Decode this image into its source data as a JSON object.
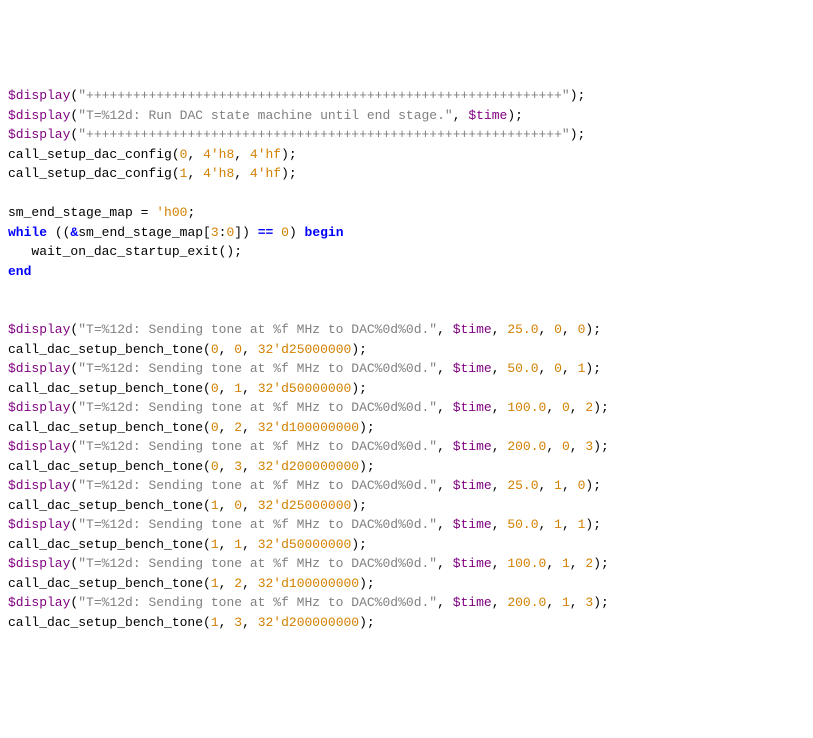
{
  "lines": [
    {
      "segs": [
        {
          "c": "sys",
          "t": "$display"
        },
        {
          "c": "pun",
          "t": "("
        },
        {
          "c": "str",
          "t": "\"+++++++++++++++++++++++++++++++++++++++++++++++++++++++++++++\""
        },
        {
          "c": "pun",
          "t": ");"
        }
      ]
    },
    {
      "segs": [
        {
          "c": "sys",
          "t": "$display"
        },
        {
          "c": "pun",
          "t": "("
        },
        {
          "c": "str",
          "t": "\"T=%12d: Run DAC state machine until end stage.\""
        },
        {
          "c": "pun",
          "t": ", "
        },
        {
          "c": "sys",
          "t": "$time"
        },
        {
          "c": "pun",
          "t": ");"
        }
      ]
    },
    {
      "segs": [
        {
          "c": "sys",
          "t": "$display"
        },
        {
          "c": "pun",
          "t": "("
        },
        {
          "c": "str",
          "t": "\"+++++++++++++++++++++++++++++++++++++++++++++++++++++++++++++\""
        },
        {
          "c": "pun",
          "t": ");"
        }
      ]
    },
    {
      "segs": [
        {
          "c": "id",
          "t": "call_setup_dac_config("
        },
        {
          "c": "num",
          "t": "0"
        },
        {
          "c": "pun",
          "t": ", "
        },
        {
          "c": "num",
          "t": "4'h8"
        },
        {
          "c": "pun",
          "t": ", "
        },
        {
          "c": "num",
          "t": "4'hf"
        },
        {
          "c": "pun",
          "t": ");"
        }
      ]
    },
    {
      "segs": [
        {
          "c": "id",
          "t": "call_setup_dac_config("
        },
        {
          "c": "num",
          "t": "1"
        },
        {
          "c": "pun",
          "t": ", "
        },
        {
          "c": "num",
          "t": "4'h8"
        },
        {
          "c": "pun",
          "t": ", "
        },
        {
          "c": "num",
          "t": "4'hf"
        },
        {
          "c": "pun",
          "t": ");"
        }
      ]
    },
    {
      "segs": [
        {
          "c": "pun",
          "t": ""
        }
      ]
    },
    {
      "segs": [
        {
          "c": "id",
          "t": "sm_end_stage_map = "
        },
        {
          "c": "num",
          "t": "'h00"
        },
        {
          "c": "pun",
          "t": ";"
        }
      ]
    },
    {
      "segs": [
        {
          "c": "kw",
          "t": "while"
        },
        {
          "c": "pun",
          "t": " (("
        },
        {
          "c": "kw",
          "t": "&"
        },
        {
          "c": "id",
          "t": "sm_end_stage_map["
        },
        {
          "c": "num",
          "t": "3"
        },
        {
          "c": "pun",
          "t": ":"
        },
        {
          "c": "num",
          "t": "0"
        },
        {
          "c": "pun",
          "t": "]) "
        },
        {
          "c": "kw",
          "t": "=="
        },
        {
          "c": "pun",
          "t": " "
        },
        {
          "c": "num",
          "t": "0"
        },
        {
          "c": "pun",
          "t": ") "
        },
        {
          "c": "kw",
          "t": "begin"
        }
      ]
    },
    {
      "segs": [
        {
          "c": "id",
          "t": "   wait_on_dac_startup_exit();"
        }
      ]
    },
    {
      "segs": [
        {
          "c": "kw",
          "t": "end"
        }
      ]
    },
    {
      "segs": [
        {
          "c": "pun",
          "t": ""
        }
      ]
    },
    {
      "segs": [
        {
          "c": "pun",
          "t": ""
        }
      ]
    },
    {
      "segs": [
        {
          "c": "sys",
          "t": "$display"
        },
        {
          "c": "pun",
          "t": "("
        },
        {
          "c": "str",
          "t": "\"T=%12d: Sending tone at %f MHz to DAC%0d%0d.\""
        },
        {
          "c": "pun",
          "t": ", "
        },
        {
          "c": "sys",
          "t": "$time"
        },
        {
          "c": "pun",
          "t": ", "
        },
        {
          "c": "num",
          "t": "25.0"
        },
        {
          "c": "pun",
          "t": ", "
        },
        {
          "c": "num",
          "t": "0"
        },
        {
          "c": "pun",
          "t": ", "
        },
        {
          "c": "num",
          "t": "0"
        },
        {
          "c": "pun",
          "t": ");"
        }
      ]
    },
    {
      "segs": [
        {
          "c": "id",
          "t": "call_dac_setup_bench_tone("
        },
        {
          "c": "num",
          "t": "0"
        },
        {
          "c": "pun",
          "t": ", "
        },
        {
          "c": "num",
          "t": "0"
        },
        {
          "c": "pun",
          "t": ", "
        },
        {
          "c": "num",
          "t": "32'd25000000"
        },
        {
          "c": "pun",
          "t": ");"
        }
      ]
    },
    {
      "segs": [
        {
          "c": "sys",
          "t": "$display"
        },
        {
          "c": "pun",
          "t": "("
        },
        {
          "c": "str",
          "t": "\"T=%12d: Sending tone at %f MHz to DAC%0d%0d.\""
        },
        {
          "c": "pun",
          "t": ", "
        },
        {
          "c": "sys",
          "t": "$time"
        },
        {
          "c": "pun",
          "t": ", "
        },
        {
          "c": "num",
          "t": "50.0"
        },
        {
          "c": "pun",
          "t": ", "
        },
        {
          "c": "num",
          "t": "0"
        },
        {
          "c": "pun",
          "t": ", "
        },
        {
          "c": "num",
          "t": "1"
        },
        {
          "c": "pun",
          "t": ");"
        }
      ]
    },
    {
      "segs": [
        {
          "c": "id",
          "t": "call_dac_setup_bench_tone("
        },
        {
          "c": "num",
          "t": "0"
        },
        {
          "c": "pun",
          "t": ", "
        },
        {
          "c": "num",
          "t": "1"
        },
        {
          "c": "pun",
          "t": ", "
        },
        {
          "c": "num",
          "t": "32'd50000000"
        },
        {
          "c": "pun",
          "t": ");"
        }
      ]
    },
    {
      "segs": [
        {
          "c": "sys",
          "t": "$display"
        },
        {
          "c": "pun",
          "t": "("
        },
        {
          "c": "str",
          "t": "\"T=%12d: Sending tone at %f MHz to DAC%0d%0d.\""
        },
        {
          "c": "pun",
          "t": ", "
        },
        {
          "c": "sys",
          "t": "$time"
        },
        {
          "c": "pun",
          "t": ", "
        },
        {
          "c": "num",
          "t": "100.0"
        },
        {
          "c": "pun",
          "t": ", "
        },
        {
          "c": "num",
          "t": "0"
        },
        {
          "c": "pun",
          "t": ", "
        },
        {
          "c": "num",
          "t": "2"
        },
        {
          "c": "pun",
          "t": ");"
        }
      ]
    },
    {
      "segs": [
        {
          "c": "id",
          "t": "call_dac_setup_bench_tone("
        },
        {
          "c": "num",
          "t": "0"
        },
        {
          "c": "pun",
          "t": ", "
        },
        {
          "c": "num",
          "t": "2"
        },
        {
          "c": "pun",
          "t": ", "
        },
        {
          "c": "num",
          "t": "32'd100000000"
        },
        {
          "c": "pun",
          "t": ");"
        }
      ]
    },
    {
      "segs": [
        {
          "c": "sys",
          "t": "$display"
        },
        {
          "c": "pun",
          "t": "("
        },
        {
          "c": "str",
          "t": "\"T=%12d: Sending tone at %f MHz to DAC%0d%0d.\""
        },
        {
          "c": "pun",
          "t": ", "
        },
        {
          "c": "sys",
          "t": "$time"
        },
        {
          "c": "pun",
          "t": ", "
        },
        {
          "c": "num",
          "t": "200.0"
        },
        {
          "c": "pun",
          "t": ", "
        },
        {
          "c": "num",
          "t": "0"
        },
        {
          "c": "pun",
          "t": ", "
        },
        {
          "c": "num",
          "t": "3"
        },
        {
          "c": "pun",
          "t": ");"
        }
      ]
    },
    {
      "segs": [
        {
          "c": "id",
          "t": "call_dac_setup_bench_tone("
        },
        {
          "c": "num",
          "t": "0"
        },
        {
          "c": "pun",
          "t": ", "
        },
        {
          "c": "num",
          "t": "3"
        },
        {
          "c": "pun",
          "t": ", "
        },
        {
          "c": "num",
          "t": "32'd200000000"
        },
        {
          "c": "pun",
          "t": ");"
        }
      ]
    },
    {
      "segs": [
        {
          "c": "sys",
          "t": "$display"
        },
        {
          "c": "pun",
          "t": "("
        },
        {
          "c": "str",
          "t": "\"T=%12d: Sending tone at %f MHz to DAC%0d%0d.\""
        },
        {
          "c": "pun",
          "t": ", "
        },
        {
          "c": "sys",
          "t": "$time"
        },
        {
          "c": "pun",
          "t": ", "
        },
        {
          "c": "num",
          "t": "25.0"
        },
        {
          "c": "pun",
          "t": ", "
        },
        {
          "c": "num",
          "t": "1"
        },
        {
          "c": "pun",
          "t": ", "
        },
        {
          "c": "num",
          "t": "0"
        },
        {
          "c": "pun",
          "t": ");"
        }
      ]
    },
    {
      "segs": [
        {
          "c": "id",
          "t": "call_dac_setup_bench_tone("
        },
        {
          "c": "num",
          "t": "1"
        },
        {
          "c": "pun",
          "t": ", "
        },
        {
          "c": "num",
          "t": "0"
        },
        {
          "c": "pun",
          "t": ", "
        },
        {
          "c": "num",
          "t": "32'd25000000"
        },
        {
          "c": "pun",
          "t": ");"
        }
      ]
    },
    {
      "segs": [
        {
          "c": "sys",
          "t": "$display"
        },
        {
          "c": "pun",
          "t": "("
        },
        {
          "c": "str",
          "t": "\"T=%12d: Sending tone at %f MHz to DAC%0d%0d.\""
        },
        {
          "c": "pun",
          "t": ", "
        },
        {
          "c": "sys",
          "t": "$time"
        },
        {
          "c": "pun",
          "t": ", "
        },
        {
          "c": "num",
          "t": "50.0"
        },
        {
          "c": "pun",
          "t": ", "
        },
        {
          "c": "num",
          "t": "1"
        },
        {
          "c": "pun",
          "t": ", "
        },
        {
          "c": "num",
          "t": "1"
        },
        {
          "c": "pun",
          "t": ");"
        }
      ]
    },
    {
      "segs": [
        {
          "c": "id",
          "t": "call_dac_setup_bench_tone("
        },
        {
          "c": "num",
          "t": "1"
        },
        {
          "c": "pun",
          "t": ", "
        },
        {
          "c": "num",
          "t": "1"
        },
        {
          "c": "pun",
          "t": ", "
        },
        {
          "c": "num",
          "t": "32'd50000000"
        },
        {
          "c": "pun",
          "t": ");"
        }
      ]
    },
    {
      "segs": [
        {
          "c": "sys",
          "t": "$display"
        },
        {
          "c": "pun",
          "t": "("
        },
        {
          "c": "str",
          "t": "\"T=%12d: Sending tone at %f MHz to DAC%0d%0d.\""
        },
        {
          "c": "pun",
          "t": ", "
        },
        {
          "c": "sys",
          "t": "$time"
        },
        {
          "c": "pun",
          "t": ", "
        },
        {
          "c": "num",
          "t": "100.0"
        },
        {
          "c": "pun",
          "t": ", "
        },
        {
          "c": "num",
          "t": "1"
        },
        {
          "c": "pun",
          "t": ", "
        },
        {
          "c": "num",
          "t": "2"
        },
        {
          "c": "pun",
          "t": ");"
        }
      ]
    },
    {
      "segs": [
        {
          "c": "id",
          "t": "call_dac_setup_bench_tone("
        },
        {
          "c": "num",
          "t": "1"
        },
        {
          "c": "pun",
          "t": ", "
        },
        {
          "c": "num",
          "t": "2"
        },
        {
          "c": "pun",
          "t": ", "
        },
        {
          "c": "num",
          "t": "32'd100000000"
        },
        {
          "c": "pun",
          "t": ");"
        }
      ]
    },
    {
      "segs": [
        {
          "c": "sys",
          "t": "$display"
        },
        {
          "c": "pun",
          "t": "("
        },
        {
          "c": "str",
          "t": "\"T=%12d: Sending tone at %f MHz to DAC%0d%0d.\""
        },
        {
          "c": "pun",
          "t": ", "
        },
        {
          "c": "sys",
          "t": "$time"
        },
        {
          "c": "pun",
          "t": ", "
        },
        {
          "c": "num",
          "t": "200.0"
        },
        {
          "c": "pun",
          "t": ", "
        },
        {
          "c": "num",
          "t": "1"
        },
        {
          "c": "pun",
          "t": ", "
        },
        {
          "c": "num",
          "t": "3"
        },
        {
          "c": "pun",
          "t": ");"
        }
      ]
    },
    {
      "segs": [
        {
          "c": "id",
          "t": "call_dac_setup_bench_tone("
        },
        {
          "c": "num",
          "t": "1"
        },
        {
          "c": "pun",
          "t": ", "
        },
        {
          "c": "num",
          "t": "3"
        },
        {
          "c": "pun",
          "t": ", "
        },
        {
          "c": "num",
          "t": "32'd200000000"
        },
        {
          "c": "pun",
          "t": ");"
        }
      ]
    }
  ]
}
